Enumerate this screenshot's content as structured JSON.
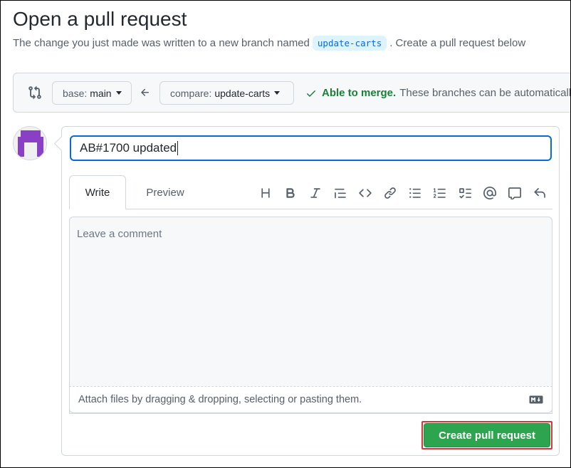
{
  "page": {
    "title": "Open a pull request",
    "subtitle_before": "The change you just made was written to a new branch named",
    "branch_name": "update-carts",
    "subtitle_after": ". Create a pull request below"
  },
  "compare": {
    "base_label": "base:",
    "base_value": "main",
    "compare_label": "compare:",
    "compare_value": "update-carts",
    "merge_status": "Able to merge.",
    "merge_description": "These branches can be automatically merged.",
    "status_color": "#1a7f37"
  },
  "form": {
    "title_value": "AB#1700 updated",
    "tabs": [
      {
        "label": "Write",
        "active": true
      },
      {
        "label": "Preview",
        "active": false
      }
    ],
    "toolbar_icons": [
      "heading-icon",
      "bold-icon",
      "italic-icon",
      "quote-icon",
      "code-icon",
      "link-icon",
      "bulleted-list-icon",
      "numbered-list-icon",
      "task-list-icon",
      "mention-icon",
      "reference-icon",
      "reply-icon"
    ],
    "comment_placeholder": "Leave a comment",
    "attach_text": "Attach files by dragging & dropping, selecting or pasting them.",
    "submit_label": "Create pull request",
    "submit_color": "#2da44e"
  }
}
